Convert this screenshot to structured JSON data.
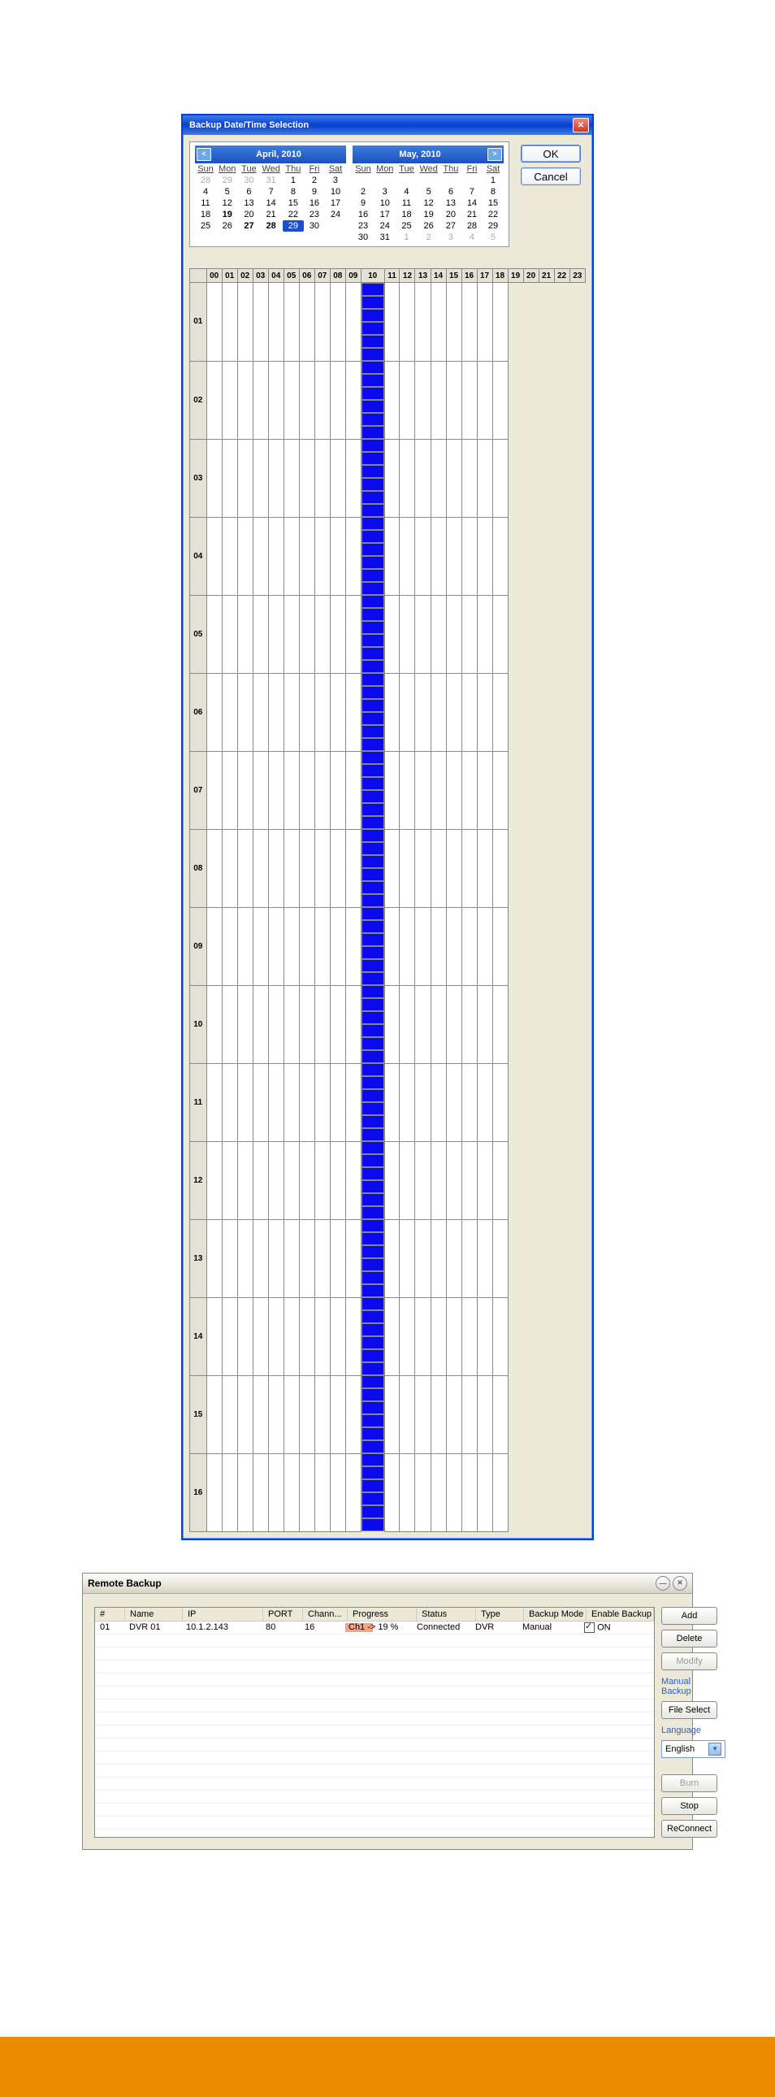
{
  "dialog1": {
    "title": "Backup Date/Time Selection",
    "ok": "OK",
    "cancel": "Cancel",
    "cal_left": {
      "label": "April, 2010",
      "dow": [
        "Sun",
        "Mon",
        "Tue",
        "Wed",
        "Thu",
        "Fri",
        "Sat"
      ],
      "lead": [
        "28",
        "29",
        "30",
        "31"
      ],
      "days": [
        "1",
        "2",
        "3",
        "4",
        "5",
        "6",
        "7",
        "8",
        "9",
        "10",
        "11",
        "12",
        "13",
        "14",
        "15",
        "16",
        "17",
        "18",
        "19",
        "20",
        "21",
        "22",
        "23",
        "24",
        "25",
        "26",
        "27",
        "28",
        "29",
        "30"
      ],
      "bold": [
        "19",
        "27",
        "28"
      ],
      "selected": "29"
    },
    "cal_right": {
      "label": "May, 2010",
      "dow": [
        "Sun",
        "Mon",
        "Tue",
        "Wed",
        "Thu",
        "Fri",
        "Sat"
      ],
      "lead_blank": 6,
      "days": [
        "1",
        "2",
        "3",
        "4",
        "5",
        "6",
        "7",
        "8",
        "9",
        "10",
        "11",
        "12",
        "13",
        "14",
        "15",
        "16",
        "17",
        "18",
        "19",
        "20",
        "21",
        "22",
        "23",
        "24",
        "25",
        "26",
        "27",
        "28",
        "29",
        "30",
        "31"
      ],
      "trail": [
        "1",
        "2",
        "3",
        "4",
        "5"
      ]
    },
    "grid": {
      "hours": [
        "00",
        "01",
        "02",
        "03",
        "04",
        "05",
        "06",
        "07",
        "08",
        "09",
        "10",
        "11",
        "12",
        "13",
        "14",
        "15",
        "16",
        "17",
        "18",
        "19",
        "20",
        "21",
        "22",
        "23"
      ],
      "rows": [
        "01",
        "02",
        "03",
        "04",
        "05",
        "06",
        "07",
        "08",
        "09",
        "10",
        "11",
        "12",
        "13",
        "14",
        "15",
        "16"
      ],
      "selected_hours": [
        "10",
        "11",
        "12",
        "13",
        "14",
        "15"
      ]
    }
  },
  "remote": {
    "title": "Remote Backup",
    "columns": [
      "#",
      "Name",
      "IP",
      "PORT",
      "Chann...",
      "Progress",
      "Status",
      "Type",
      "Backup Mode",
      "Enable Backup"
    ],
    "row": {
      "num": "01",
      "name": "DVR 01",
      "ip": "10.1.2.143",
      "port": "80",
      "chan": "16",
      "progress_text": "Ch1 -> 19 %",
      "status": "Connected",
      "type": "DVR",
      "mode": "Manual",
      "enable": "ON"
    },
    "buttons": {
      "add": "Add",
      "delete": "Delete",
      "modify": "Modify",
      "manual": "Manual Backup",
      "file_select": "File Select",
      "language": "Language",
      "lang_value": "English",
      "burn": "Burn",
      "stop": "Stop",
      "reconnect": "ReConnect"
    }
  }
}
